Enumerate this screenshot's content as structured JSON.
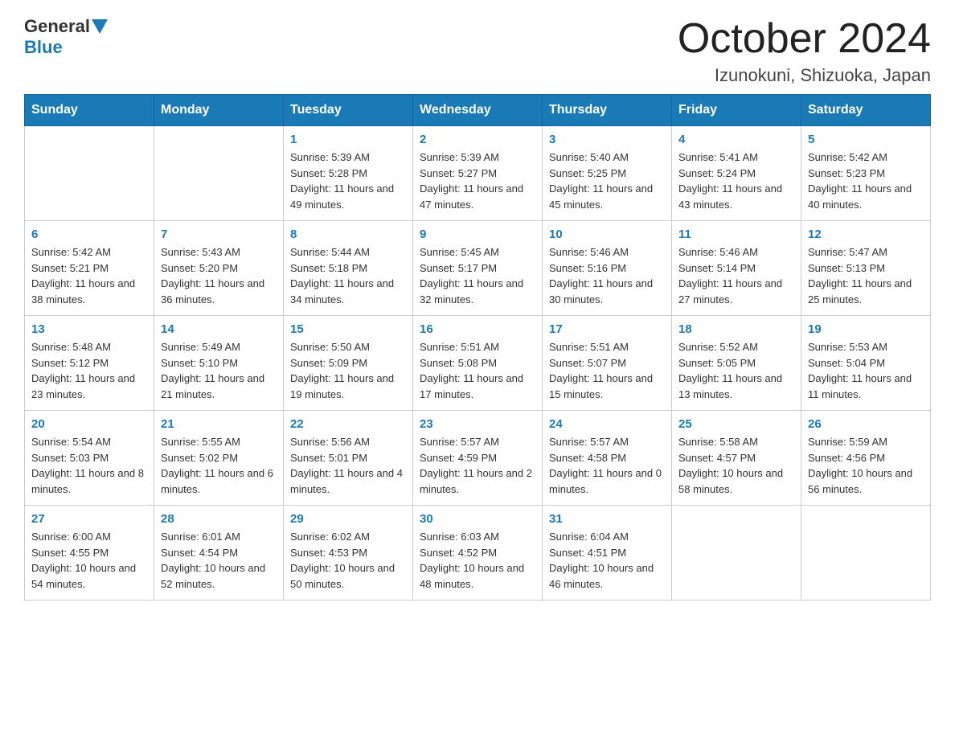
{
  "header": {
    "logo_general": "General",
    "logo_blue": "Blue",
    "month_title": "October 2024",
    "location": "Izunokuni, Shizuoka, Japan"
  },
  "days_of_week": [
    "Sunday",
    "Monday",
    "Tuesday",
    "Wednesday",
    "Thursday",
    "Friday",
    "Saturday"
  ],
  "weeks": [
    [
      {
        "day": "",
        "sunrise": "",
        "sunset": "",
        "daylight": ""
      },
      {
        "day": "",
        "sunrise": "",
        "sunset": "",
        "daylight": ""
      },
      {
        "day": "1",
        "sunrise": "Sunrise: 5:39 AM",
        "sunset": "Sunset: 5:28 PM",
        "daylight": "Daylight: 11 hours and 49 minutes."
      },
      {
        "day": "2",
        "sunrise": "Sunrise: 5:39 AM",
        "sunset": "Sunset: 5:27 PM",
        "daylight": "Daylight: 11 hours and 47 minutes."
      },
      {
        "day": "3",
        "sunrise": "Sunrise: 5:40 AM",
        "sunset": "Sunset: 5:25 PM",
        "daylight": "Daylight: 11 hours and 45 minutes."
      },
      {
        "day": "4",
        "sunrise": "Sunrise: 5:41 AM",
        "sunset": "Sunset: 5:24 PM",
        "daylight": "Daylight: 11 hours and 43 minutes."
      },
      {
        "day": "5",
        "sunrise": "Sunrise: 5:42 AM",
        "sunset": "Sunset: 5:23 PM",
        "daylight": "Daylight: 11 hours and 40 minutes."
      }
    ],
    [
      {
        "day": "6",
        "sunrise": "Sunrise: 5:42 AM",
        "sunset": "Sunset: 5:21 PM",
        "daylight": "Daylight: 11 hours and 38 minutes."
      },
      {
        "day": "7",
        "sunrise": "Sunrise: 5:43 AM",
        "sunset": "Sunset: 5:20 PM",
        "daylight": "Daylight: 11 hours and 36 minutes."
      },
      {
        "day": "8",
        "sunrise": "Sunrise: 5:44 AM",
        "sunset": "Sunset: 5:18 PM",
        "daylight": "Daylight: 11 hours and 34 minutes."
      },
      {
        "day": "9",
        "sunrise": "Sunrise: 5:45 AM",
        "sunset": "Sunset: 5:17 PM",
        "daylight": "Daylight: 11 hours and 32 minutes."
      },
      {
        "day": "10",
        "sunrise": "Sunrise: 5:46 AM",
        "sunset": "Sunset: 5:16 PM",
        "daylight": "Daylight: 11 hours and 30 minutes."
      },
      {
        "day": "11",
        "sunrise": "Sunrise: 5:46 AM",
        "sunset": "Sunset: 5:14 PM",
        "daylight": "Daylight: 11 hours and 27 minutes."
      },
      {
        "day": "12",
        "sunrise": "Sunrise: 5:47 AM",
        "sunset": "Sunset: 5:13 PM",
        "daylight": "Daylight: 11 hours and 25 minutes."
      }
    ],
    [
      {
        "day": "13",
        "sunrise": "Sunrise: 5:48 AM",
        "sunset": "Sunset: 5:12 PM",
        "daylight": "Daylight: 11 hours and 23 minutes."
      },
      {
        "day": "14",
        "sunrise": "Sunrise: 5:49 AM",
        "sunset": "Sunset: 5:10 PM",
        "daylight": "Daylight: 11 hours and 21 minutes."
      },
      {
        "day": "15",
        "sunrise": "Sunrise: 5:50 AM",
        "sunset": "Sunset: 5:09 PM",
        "daylight": "Daylight: 11 hours and 19 minutes."
      },
      {
        "day": "16",
        "sunrise": "Sunrise: 5:51 AM",
        "sunset": "Sunset: 5:08 PM",
        "daylight": "Daylight: 11 hours and 17 minutes."
      },
      {
        "day": "17",
        "sunrise": "Sunrise: 5:51 AM",
        "sunset": "Sunset: 5:07 PM",
        "daylight": "Daylight: 11 hours and 15 minutes."
      },
      {
        "day": "18",
        "sunrise": "Sunrise: 5:52 AM",
        "sunset": "Sunset: 5:05 PM",
        "daylight": "Daylight: 11 hours and 13 minutes."
      },
      {
        "day": "19",
        "sunrise": "Sunrise: 5:53 AM",
        "sunset": "Sunset: 5:04 PM",
        "daylight": "Daylight: 11 hours and 11 minutes."
      }
    ],
    [
      {
        "day": "20",
        "sunrise": "Sunrise: 5:54 AM",
        "sunset": "Sunset: 5:03 PM",
        "daylight": "Daylight: 11 hours and 8 minutes."
      },
      {
        "day": "21",
        "sunrise": "Sunrise: 5:55 AM",
        "sunset": "Sunset: 5:02 PM",
        "daylight": "Daylight: 11 hours and 6 minutes."
      },
      {
        "day": "22",
        "sunrise": "Sunrise: 5:56 AM",
        "sunset": "Sunset: 5:01 PM",
        "daylight": "Daylight: 11 hours and 4 minutes."
      },
      {
        "day": "23",
        "sunrise": "Sunrise: 5:57 AM",
        "sunset": "Sunset: 4:59 PM",
        "daylight": "Daylight: 11 hours and 2 minutes."
      },
      {
        "day": "24",
        "sunrise": "Sunrise: 5:57 AM",
        "sunset": "Sunset: 4:58 PM",
        "daylight": "Daylight: 11 hours and 0 minutes."
      },
      {
        "day": "25",
        "sunrise": "Sunrise: 5:58 AM",
        "sunset": "Sunset: 4:57 PM",
        "daylight": "Daylight: 10 hours and 58 minutes."
      },
      {
        "day": "26",
        "sunrise": "Sunrise: 5:59 AM",
        "sunset": "Sunset: 4:56 PM",
        "daylight": "Daylight: 10 hours and 56 minutes."
      }
    ],
    [
      {
        "day": "27",
        "sunrise": "Sunrise: 6:00 AM",
        "sunset": "Sunset: 4:55 PM",
        "daylight": "Daylight: 10 hours and 54 minutes."
      },
      {
        "day": "28",
        "sunrise": "Sunrise: 6:01 AM",
        "sunset": "Sunset: 4:54 PM",
        "daylight": "Daylight: 10 hours and 52 minutes."
      },
      {
        "day": "29",
        "sunrise": "Sunrise: 6:02 AM",
        "sunset": "Sunset: 4:53 PM",
        "daylight": "Daylight: 10 hours and 50 minutes."
      },
      {
        "day": "30",
        "sunrise": "Sunrise: 6:03 AM",
        "sunset": "Sunset: 4:52 PM",
        "daylight": "Daylight: 10 hours and 48 minutes."
      },
      {
        "day": "31",
        "sunrise": "Sunrise: 6:04 AM",
        "sunset": "Sunset: 4:51 PM",
        "daylight": "Daylight: 10 hours and 46 minutes."
      },
      {
        "day": "",
        "sunrise": "",
        "sunset": "",
        "daylight": ""
      },
      {
        "day": "",
        "sunrise": "",
        "sunset": "",
        "daylight": ""
      }
    ]
  ]
}
